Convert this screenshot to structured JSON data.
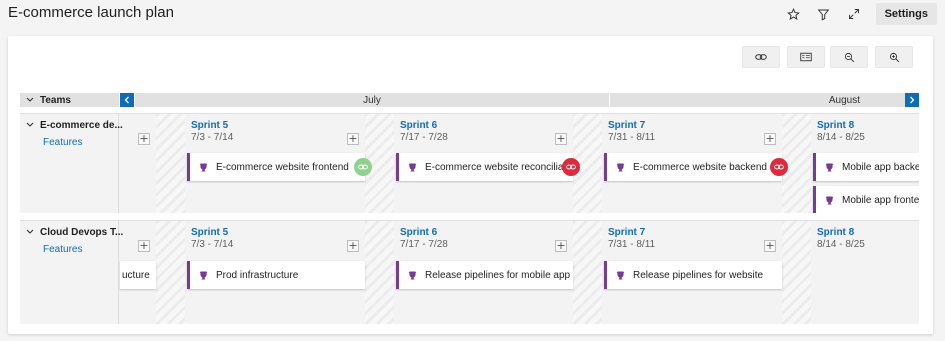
{
  "page": {
    "title": "E-commerce launch plan",
    "settings_label": "Settings"
  },
  "header": {
    "teams_label": "Teams",
    "months": [
      "July",
      "August"
    ]
  },
  "colors": {
    "accent": "#0f6cbd",
    "feature_bar": "#773b93",
    "dep_ok": "#8fd18f",
    "dep_error": "#e0293c"
  },
  "teams": [
    {
      "name": "E-commerce de...",
      "backlog": "Features",
      "sprints": [
        {
          "name": "Sprint 5",
          "dates": "7/3 - 7/14"
        },
        {
          "name": "Sprint 6",
          "dates": "7/17 - 7/28"
        },
        {
          "name": "Sprint 7",
          "dates": "7/31 - 8/11"
        },
        {
          "name": "Sprint 8",
          "dates": "8/14 - 8/25"
        }
      ],
      "features": [
        "E-commerce website frontend",
        "E-commerce website reconciliation...",
        "E-commerce website backend",
        "Mobile app backend",
        "Mobile app frontend"
      ]
    },
    {
      "name": "Cloud Devops T...",
      "backlog": "Features",
      "sprints": [
        {
          "name": "Sprint 5",
          "dates": "7/3 - 7/14"
        },
        {
          "name": "Sprint 6",
          "dates": "7/17 - 7/28"
        },
        {
          "name": "Sprint 7",
          "dates": "7/31 - 8/11"
        },
        {
          "name": "Sprint 8",
          "dates": "8/14 - 8/25"
        }
      ],
      "features": [
        "ucture",
        "Prod infrastructure",
        "Release pipelines for mobile app",
        "Release pipelines for website"
      ]
    }
  ]
}
